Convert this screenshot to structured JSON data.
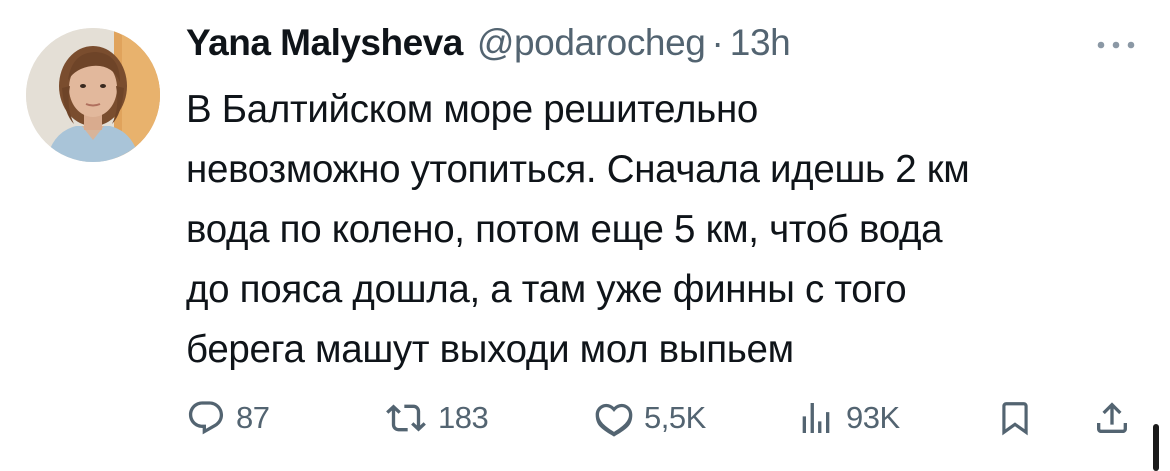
{
  "author": {
    "display_name": "Yana Malysheva",
    "handle": "@podarocheg",
    "separator": "·",
    "time": "13h"
  },
  "tweet": {
    "text": "В Балтийском море решительно\nневозможно утопиться. Сначала идешь 2 км\nвода по колено, потом еще 5 км, чтоб вода\nдо пояса дошла, а там уже финны с того\nберега машут выходи мол выпьем"
  },
  "actions": {
    "replies": "87",
    "retweets": "183",
    "likes": "5,5K",
    "views": "93K"
  },
  "icons": {
    "more": "more-horizontal-icon",
    "reply": "reply-bubble-icon",
    "retweet": "retweet-arrows-icon",
    "like": "heart-icon",
    "views": "bar-chart-icon",
    "bookmark": "bookmark-icon",
    "share": "share-upload-icon"
  },
  "colors": {
    "text": "#0f1419",
    "secondary": "#536471",
    "background": "#ffffff"
  }
}
